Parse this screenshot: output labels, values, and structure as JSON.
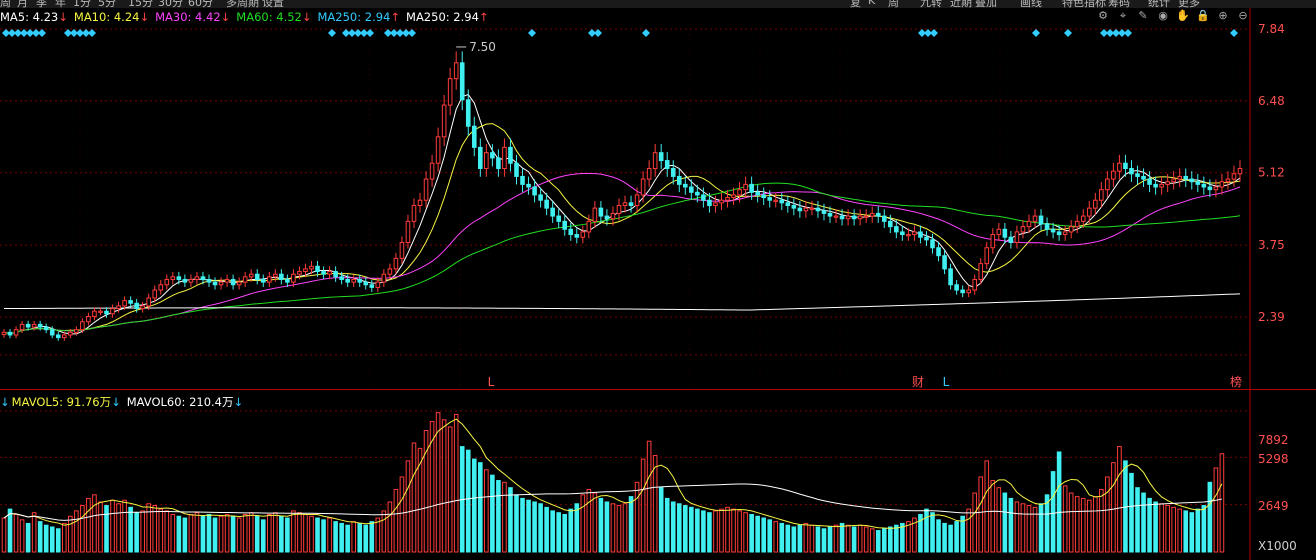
{
  "topbar": [
    "周",
    "月",
    "季",
    "年",
    "1分",
    "5分",
    "15分",
    "30分",
    "60分",
    "多周期",
    "设置",
    "复",
    "K",
    "周",
    "九转",
    "近期",
    "叠加",
    "画线",
    "特色指标",
    "筹码",
    "统计",
    "更多"
  ],
  "ma_legend": [
    {
      "label": "MA5: 4.23",
      "arrow": "↓",
      "color": "#ffffff"
    },
    {
      "label": "MA10: 4.24",
      "arrow": "↓",
      "color": "#f5f542"
    },
    {
      "label": "MA30: 4.42",
      "arrow": "↓",
      "color": "#ff44ff"
    },
    {
      "label": "MA60: 4.52",
      "arrow": "↓",
      "color": "#22dd22"
    },
    {
      "label": "MA250: 2.94",
      "arrow": "↑",
      "color": "#33ccff"
    },
    {
      "label": "MA250: 2.94",
      "arrow": "↑",
      "color": "#ffffff"
    }
  ],
  "vol_legend": [
    {
      "label": "MAVOL5: 91.76万",
      "arrow": "↓",
      "color": "#f5f542"
    },
    {
      "label": "MAVOL60: 210.4万",
      "arrow": "↓",
      "color": "#ffffff"
    }
  ],
  "tools": [
    "gear-icon",
    "pin-icon",
    "edit-icon",
    "eye-icon",
    "hand-icon",
    "lock-icon",
    "plus-icon",
    "minus-icon"
  ],
  "price_ticks": [
    "7.84",
    "6.48",
    "5.12",
    "3.75",
    "2.39"
  ],
  "volume_ticks": [
    "7892",
    "5298",
    "2649",
    "X1000"
  ],
  "annotation_high": "7.50",
  "chart_markers": [
    "L",
    "财",
    "L",
    "榜"
  ],
  "colors": {
    "up": "#ff3b3b",
    "down": "#40f0f0",
    "ma5": "#ffffff",
    "ma10": "#f5f542",
    "ma30": "#ff44ff",
    "ma60": "#22dd22",
    "ma250": "#ffffff",
    "grid": "#7a0000",
    "axis": "#b00000"
  },
  "chart_data": {
    "type": "candlestick",
    "y_axis": {
      "ticks": [
        7.84,
        6.48,
        5.12,
        3.75,
        2.39
      ]
    },
    "volume_axis": {
      "ticks": [
        7892,
        5298,
        2649
      ],
      "unit": "X1000"
    },
    "high_label": 7.5,
    "closes": [
      2.1,
      2.05,
      2.15,
      2.25,
      2.2,
      2.25,
      2.2,
      2.15,
      2.05,
      2.0,
      2.05,
      2.1,
      2.15,
      2.3,
      2.4,
      2.5,
      2.5,
      2.45,
      2.55,
      2.6,
      2.7,
      2.65,
      2.55,
      2.6,
      2.75,
      2.9,
      3.0,
      3.1,
      3.15,
      3.1,
      3.05,
      3.1,
      3.15,
      3.1,
      3.05,
      3.0,
      3.05,
      3.1,
      3.0,
      3.05,
      3.15,
      3.2,
      3.1,
      3.05,
      3.15,
      3.2,
      3.1,
      3.05,
      3.2,
      3.25,
      3.3,
      3.35,
      3.25,
      3.2,
      3.25,
      3.15,
      3.1,
      3.05,
      3.1,
      3.05,
      3.0,
      2.95,
      3.05,
      3.2,
      3.3,
      3.5,
      3.8,
      4.2,
      4.5,
      4.6,
      5.0,
      5.3,
      5.8,
      6.4,
      6.9,
      7.2,
      6.5,
      6.0,
      5.6,
      5.2,
      5.5,
      5.4,
      5.2,
      5.6,
      5.3,
      5.05,
      4.9,
      4.85,
      4.7,
      4.6,
      4.45,
      4.3,
      4.2,
      4.05,
      3.95,
      3.9,
      4.0,
      4.2,
      4.45,
      4.3,
      4.25,
      4.35,
      4.5,
      4.55,
      4.5,
      4.7,
      5.0,
      5.2,
      5.5,
      5.35,
      5.2,
      5.05,
      4.9,
      4.85,
      4.75,
      4.7,
      4.6,
      4.5,
      4.55,
      4.6,
      4.65,
      4.7,
      4.8,
      4.9,
      4.75,
      4.7,
      4.65,
      4.6,
      4.6,
      4.55,
      4.5,
      4.45,
      4.4,
      4.45,
      4.45,
      4.4,
      4.35,
      4.3,
      4.3,
      4.25,
      4.3,
      4.25,
      4.3,
      4.3,
      4.35,
      4.3,
      4.2,
      4.1,
      4.0,
      3.95,
      3.95,
      4.0,
      3.9,
      3.85,
      3.7,
      3.55,
      3.3,
      3.0,
      2.9,
      2.85,
      2.9,
      3.1,
      3.4,
      3.7,
      3.95,
      4.05,
      3.9,
      3.8,
      4.0,
      4.1,
      4.2,
      4.3,
      4.15,
      4.05,
      4.0,
      3.95,
      4.0,
      4.1,
      4.2,
      4.3,
      4.45,
      4.6,
      4.8,
      5.0,
      5.15,
      5.3,
      5.2,
      5.1,
      5.05,
      5.0,
      4.9,
      4.85,
      4.9,
      4.95,
      5.0,
      5.05,
      5.0,
      4.95,
      4.9,
      4.85,
      4.8,
      4.85,
      4.95,
      5.0,
      5.1,
      5.2
    ],
    "volumes": [
      1900,
      2400,
      2100,
      1800,
      1600,
      2200,
      1700,
      1500,
      1400,
      1300,
      1600,
      2000,
      2300,
      2600,
      3000,
      3200,
      2800,
      2600,
      2900,
      2700,
      2900,
      2500,
      2200,
      2300,
      2700,
      2600,
      2400,
      2300,
      2100,
      2000,
      1900,
      2100,
      2200,
      2000,
      2100,
      1900,
      2000,
      2100,
      2000,
      1900,
      2100,
      2200,
      2000,
      1800,
      2100,
      2200,
      2000,
      1900,
      2300,
      2200,
      2100,
      2000,
      1900,
      1800,
      1900,
      1700,
      1600,
      1500,
      1700,
      1600,
      1500,
      1700,
      1900,
      2300,
      2800,
      3500,
      4200,
      5100,
      6100,
      5800,
      6800,
      7300,
      7800,
      7400,
      7000,
      7700,
      5900,
      5700,
      5200,
      5000,
      4600,
      4300,
      4000,
      3900,
      3600,
      3200,
      3000,
      2900,
      2800,
      2700,
      2500,
      2300,
      2200,
      2100,
      2400,
      2700,
      3200,
      3500,
      3300,
      3000,
      2800,
      2700,
      2600,
      2700,
      3100,
      3900,
      5200,
      6200,
      5400,
      3600,
      3000,
      2800,
      2700,
      2600,
      2500,
      2400,
      2300,
      2200,
      2300,
      2400,
      2500,
      2400,
      2300,
      2200,
      2100,
      2000,
      1900,
      1800,
      1700,
      1600,
      1500,
      1400,
      1500,
      1600,
      1500,
      1400,
      1300,
      1400,
      1500,
      1600,
      1500,
      1400,
      1500,
      1400,
      1300,
      1200,
      1300,
      1400,
      1500,
      1600,
      1700,
      1900,
      2100,
      2400,
      2200,
      1800,
      1600,
      1500,
      1700,
      2000,
      2400,
      3300,
      4200,
      5100,
      4000,
      3600,
      3300,
      3000,
      2800,
      2700,
      2600,
      2500,
      2700,
      3200,
      4500,
      5600,
      3700,
      3300,
      3100,
      3000,
      2900,
      3100,
      3500,
      4200,
      5000,
      5900,
      5100,
      4400,
      3600,
      3300,
      3000,
      2800,
      2700,
      2600,
      2500,
      2400,
      2300,
      2200,
      2400,
      2600,
      3900,
      4700,
      5500
    ]
  }
}
